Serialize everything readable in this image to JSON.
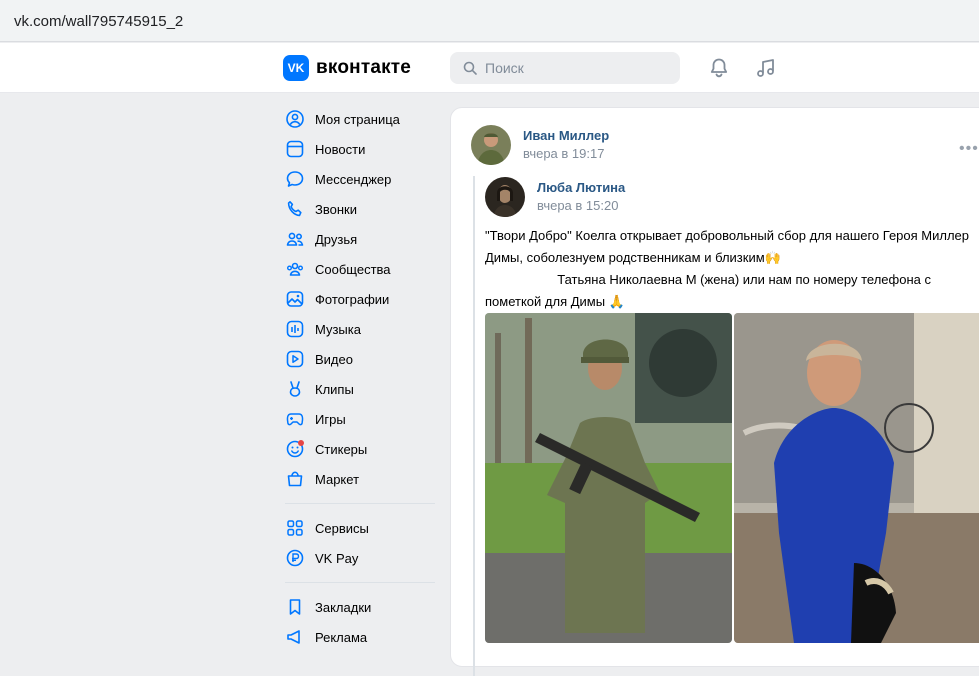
{
  "browser": {
    "url": "vk.com/wall795745915_2"
  },
  "header": {
    "logo_mark": "VK",
    "logo_text": "вконтакте",
    "search_placeholder": "Поиск",
    "icons": [
      "bell-icon",
      "music-icon"
    ]
  },
  "sidebar": {
    "items": [
      {
        "label": "Моя страница",
        "icon": "user-circle-icon"
      },
      {
        "label": "Новости",
        "icon": "news-icon"
      },
      {
        "label": "Мессенджер",
        "icon": "message-icon"
      },
      {
        "label": "Звонки",
        "icon": "phone-icon"
      },
      {
        "label": "Друзья",
        "icon": "friends-icon"
      },
      {
        "label": "Сообщества",
        "icon": "groups-icon"
      },
      {
        "label": "Фотографии",
        "icon": "photo-icon"
      },
      {
        "label": "Музыка",
        "icon": "music-bars-icon"
      },
      {
        "label": "Видео",
        "icon": "video-icon"
      },
      {
        "label": "Клипы",
        "icon": "clips-icon"
      },
      {
        "label": "Игры",
        "icon": "gamepad-icon"
      },
      {
        "label": "Стикеры",
        "icon": "sticker-icon"
      },
      {
        "label": "Маркет",
        "icon": "market-bag-icon"
      }
    ],
    "items2": [
      {
        "label": "Сервисы",
        "icon": "services-grid-icon"
      },
      {
        "label": "VK Pay",
        "icon": "vkpay-icon"
      }
    ],
    "items3": [
      {
        "label": "Закладки",
        "icon": "bookmark-icon"
      },
      {
        "label": "Реклама",
        "icon": "megaphone-icon"
      }
    ],
    "badge_color": "#e64646"
  },
  "post": {
    "author": "Иван Миллер",
    "time": "вчера в 19:17",
    "more": "•••",
    "repost": {
      "author": "Люба Лютина",
      "time": "вчера в 15:20",
      "text_lines": [
        "\"Твори Добро\" Коелга открывает добровольный сбор для нашего Героя Миллер",
        "Димы, соболезнуем родственникам и близким🙌",
        "                    Татьяна Николаевна М (жена) или нам по номеру телефона с",
        "пометкой для Димы 🙏"
      ]
    }
  },
  "colors": {
    "accent": "#0077ff",
    "link": "#2a5885",
    "muted": "#818c99",
    "page_bg": "#edeef0"
  }
}
